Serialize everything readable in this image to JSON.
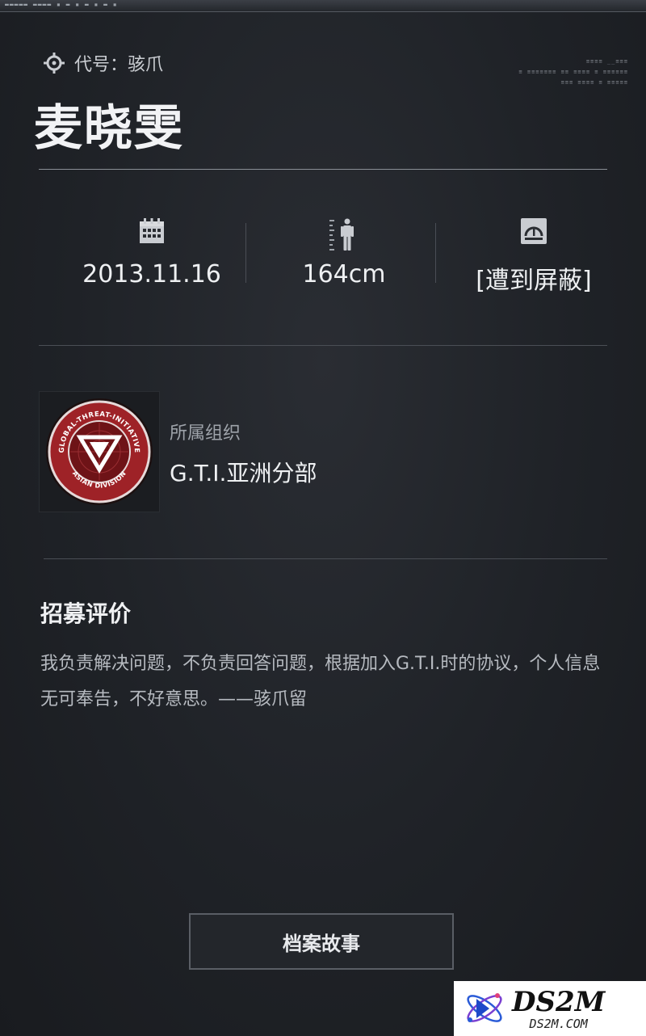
{
  "window": {
    "topbar_text": "▬▬▬▬▬ ▬▬▬▬ ▪ ▬ ▪ ▬ ▪ ▬ ▪"
  },
  "header": {
    "codename": "代号：骇爪",
    "name": "麦晓雯",
    "hud_lines": [
      "≡≡≡≡ __≡≡≡",
      "≡ ≡≡≡≡≡≡≡ ≡≡ ≡≡≡≡ ≡ ≡≡≡≡≡≡",
      "≡≡≡ ≡≡≡≡ ≡ ≡≡≡≡≡"
    ]
  },
  "stats": [
    {
      "icon": "calendar-icon",
      "value": "2013.11.16"
    },
    {
      "icon": "height-figure-icon",
      "value": "164cm"
    },
    {
      "icon": "gauge-icon",
      "value": "[遭到屏蔽]"
    }
  ],
  "organization": {
    "label": "所属组织",
    "value": "G.T.I.亚洲分部",
    "badge_top_text": "GLOBAL-THREAT-INITIATIVE",
    "badge_bottom_text": "ASIAN DIVISION"
  },
  "evaluation": {
    "title": "招募评价",
    "text": "我负责解决问题，不负责回答问题，根据加入G.T.I.时的协议，个人信息无可奉告，不好意思。——骇爪留"
  },
  "actions": {
    "archive_button": "档案故事"
  },
  "watermark": {
    "title": "DS2M",
    "subtitle": "DS2M.COM"
  },
  "colors": {
    "background": "#1f2227",
    "text": "#eef0f2",
    "muted": "#9ea3aa",
    "badge_red": "#b3262c"
  }
}
